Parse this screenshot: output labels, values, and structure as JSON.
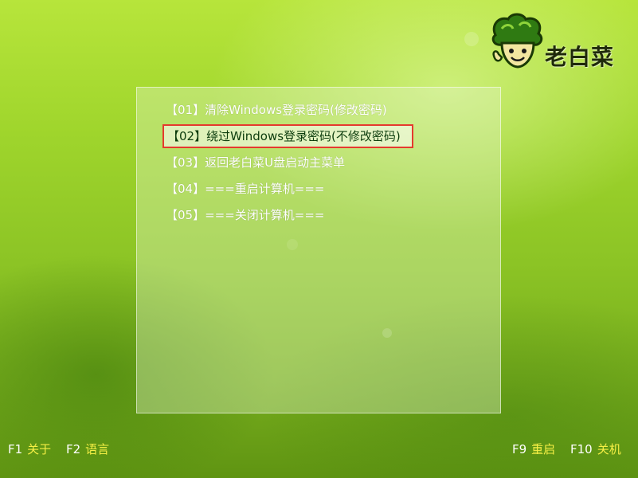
{
  "logo": {
    "name": "老白菜"
  },
  "menu": {
    "items": [
      {
        "label": "【01】清除Windows登录密码(修改密码)"
      },
      {
        "label": "【02】绕过Windows登录密码(不修改密码)"
      },
      {
        "label": "【03】返回老白菜U盘启动主菜单"
      },
      {
        "label": "【04】===重启计算机==="
      },
      {
        "label": "【05】===关闭计算机==="
      }
    ],
    "selected_index": 1
  },
  "footer": {
    "left": [
      {
        "key": "F1",
        "label": "关于"
      },
      {
        "key": "F2",
        "label": "语言"
      }
    ],
    "right": [
      {
        "key": "F9",
        "label": "重启"
      },
      {
        "key": "F10",
        "label": "关机"
      }
    ]
  },
  "colors": {
    "selection_border": "#e53a2e",
    "hotkey_label": "#f6ef45",
    "menu_text": "#ffffff",
    "selected_text": "#0d3d0d"
  },
  "icons": {
    "logo": "cabbage-mascot-icon"
  }
}
